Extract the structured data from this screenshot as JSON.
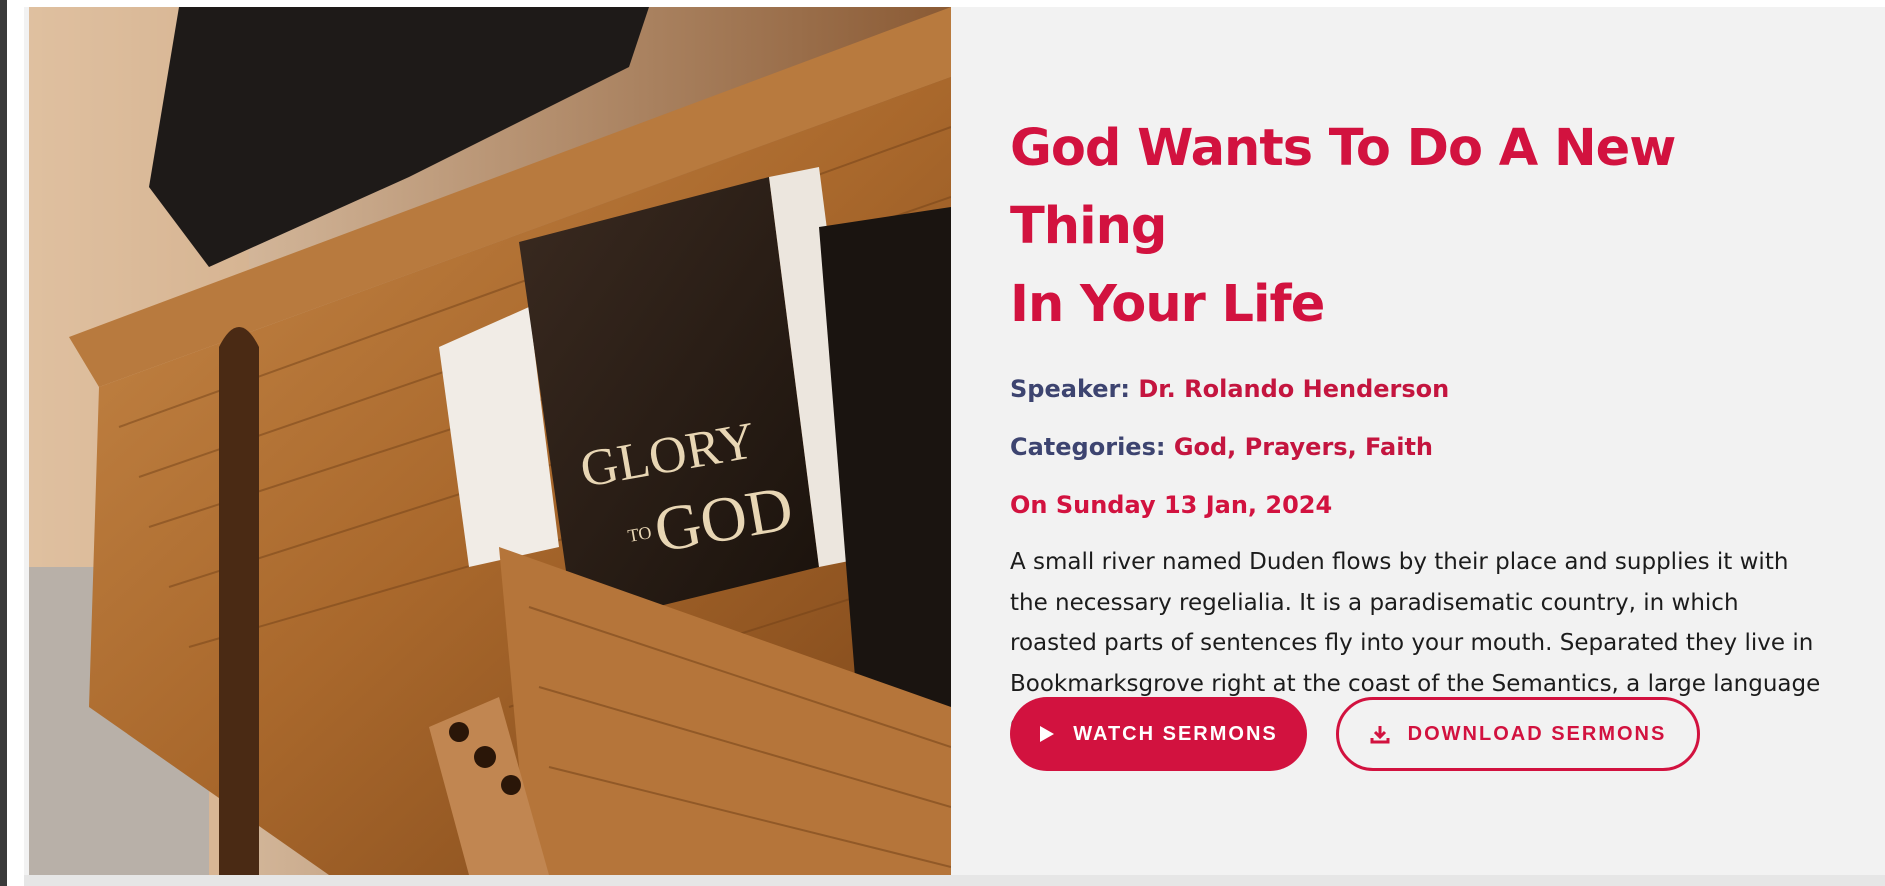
{
  "colors": {
    "accent": "#d2123f",
    "label": "#3d4470",
    "text": "#1c1c1c",
    "card_bg": "#f2f2f2"
  },
  "image": {
    "book_title_line1": "GLORY",
    "book_title_small": "TO",
    "book_title_line2": "GOD"
  },
  "sermon": {
    "title_line1": "God Wants To Do A New Thing",
    "title_line2": "In Your Life",
    "speaker_label": "Speaker:",
    "speaker_value": "Dr. Rolando Henderson",
    "categories_label": "Categories:",
    "categories_value": "God, Prayers, Faith",
    "date": "On Sunday 13 Jan, 2024",
    "description": "A small river named Duden flows by their place and supplies it with the necessary regelialia. It is a paradisematic country, in which roasted parts of sentences fly into your mouth. Separated they live in Bookmarksgrove right at the coast of the Semantics, a large language ocean."
  },
  "buttons": {
    "watch_label": "WATCH SERMONS",
    "watch_icon": "play-icon",
    "download_label": "DOWNLOAD SERMONS",
    "download_icon": "download-icon"
  }
}
